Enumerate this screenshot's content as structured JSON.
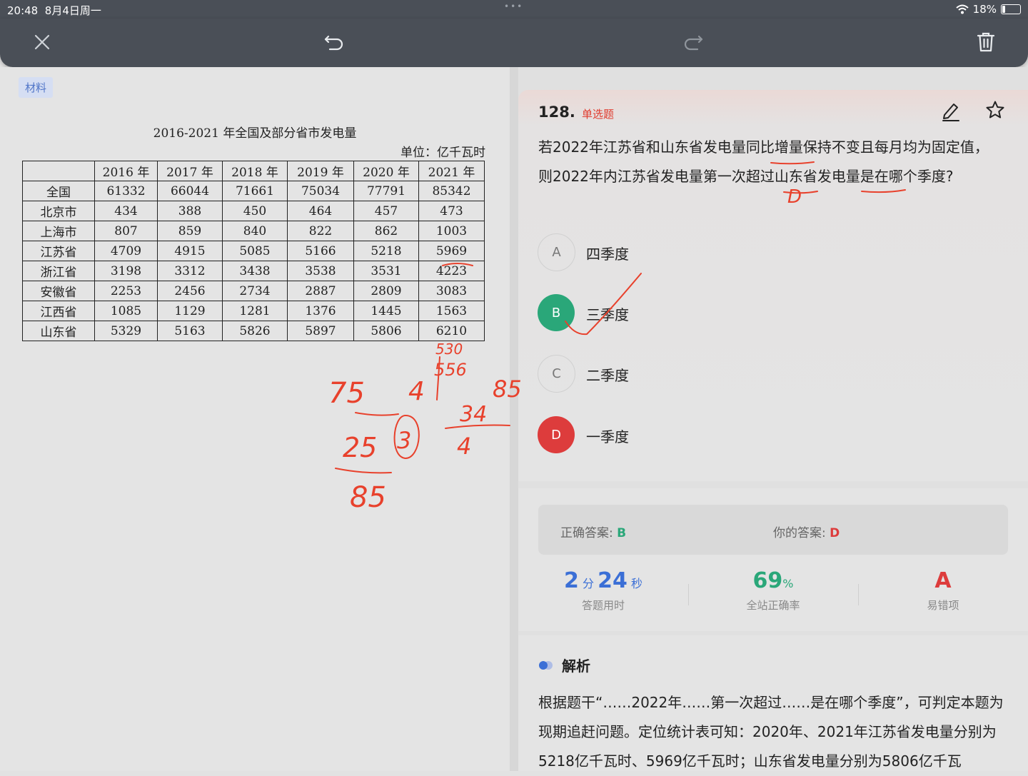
{
  "status": {
    "time": "20:48",
    "date": "8月4日周一",
    "battery": "18%",
    "battery_level": 0.18
  },
  "material_tag": "材料",
  "table": {
    "title": "2016-2021 年全国及部分省市发电量",
    "unit": "单位：亿千瓦时",
    "headers": [
      "",
      "2016 年",
      "2017 年",
      "2018 年",
      "2019 年",
      "2020 年",
      "2021 年"
    ],
    "rows": [
      [
        "全国",
        "61332",
        "66044",
        "71661",
        "75034",
        "77791",
        "85342"
      ],
      [
        "北京市",
        "434",
        "388",
        "450",
        "464",
        "457",
        "473"
      ],
      [
        "上海市",
        "807",
        "859",
        "840",
        "822",
        "862",
        "1003"
      ],
      [
        "江苏省",
        "4709",
        "4915",
        "5085",
        "5166",
        "5218",
        "5969"
      ],
      [
        "浙江省",
        "3198",
        "3312",
        "3438",
        "3538",
        "3531",
        "4223"
      ],
      [
        "安徽省",
        "2253",
        "2456",
        "2734",
        "2887",
        "2809",
        "3083"
      ],
      [
        "江西省",
        "1085",
        "1129",
        "1281",
        "1376",
        "1445",
        "1563"
      ],
      [
        "山东省",
        "5329",
        "5163",
        "5826",
        "5897",
        "5806",
        "6210"
      ]
    ]
  },
  "question": {
    "number": "128.",
    "type": "单选题",
    "text": "若2022年江苏省和山东省发电量同比增量保持不变且每月均为固定值，则2022年内江苏省发电量第一次超过山东省发电量是在哪个季度?",
    "options": [
      {
        "letter": "A",
        "text": "四季度",
        "state": "plain"
      },
      {
        "letter": "B",
        "text": "三季度",
        "state": "correct"
      },
      {
        "letter": "C",
        "text": "二季度",
        "state": "plain"
      },
      {
        "letter": "D",
        "text": "一季度",
        "state": "wrong"
      }
    ]
  },
  "result": {
    "correct_label": "正确答案:",
    "correct_value": "B",
    "your_label": "你的答案:",
    "your_value": "D",
    "time_min": "2",
    "time_min_unit": "分",
    "time_sec": "24",
    "time_sec_unit": "秒",
    "time_caption": "答题用时",
    "accuracy": "69",
    "accuracy_unit": "%",
    "accuracy_caption": "全站正确率",
    "common_wrong": "A",
    "common_wrong_caption": "易错项"
  },
  "analysis": {
    "title": "解析",
    "text": "根据题干“……2022年……第一次超过……是在哪个季度”，可判定本题为现期追赶问题。定位统计表可知：2020年、2021年江苏省发电量分别为5218亿千瓦时、5969亿千瓦时；山东省发电量分别为5806亿千瓦"
  },
  "handwriting": {
    "color": "#e8412c",
    "marks": [
      "75",
      "4",
      "85",
      "34",
      "4",
      "25",
      "3",
      "85",
      "530",
      "556",
      "D"
    ]
  },
  "colors": {
    "toolbar": "#4a4f57",
    "correct": "#2aa779",
    "wrong": "#dd3c3c",
    "accent_blue": "#3b6fd6",
    "ink": "#e8412c"
  }
}
